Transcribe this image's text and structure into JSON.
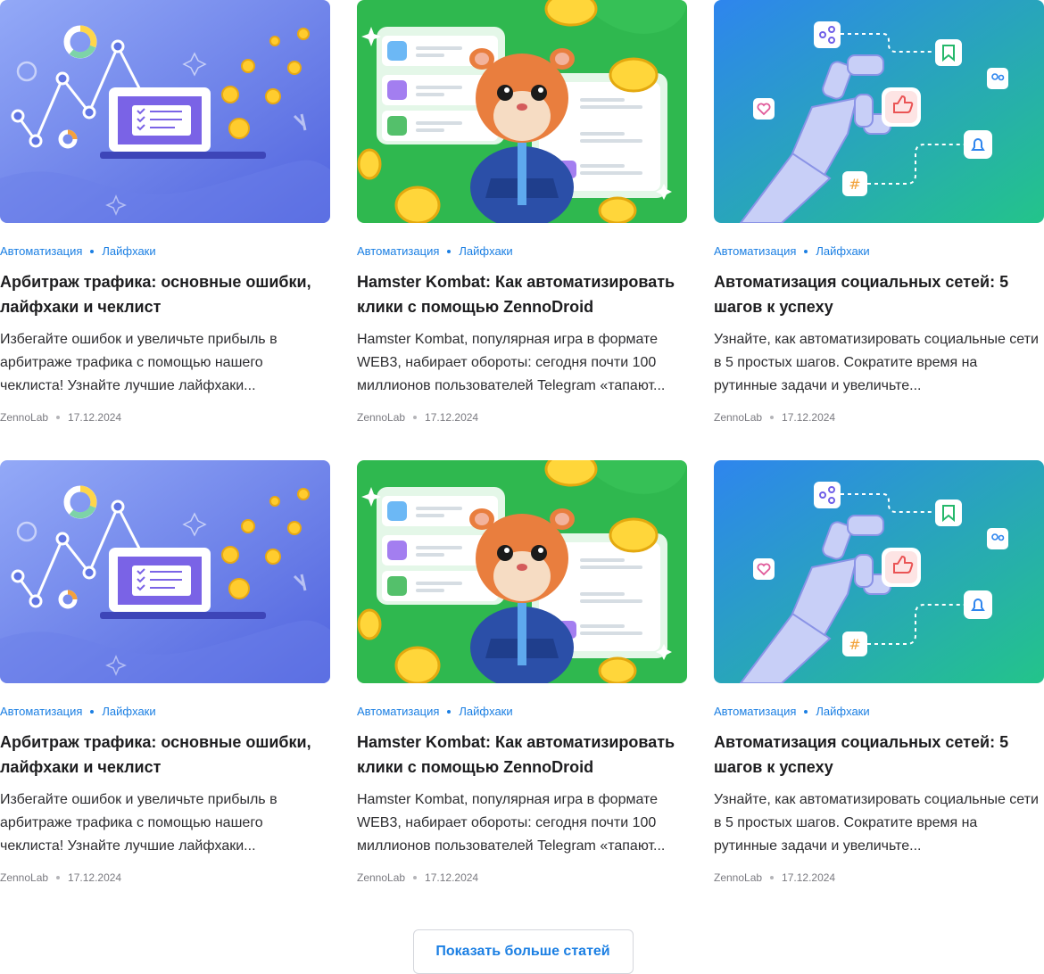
{
  "articles": [
    {
      "image": "arbitrage-illustration",
      "tags": [
        "Автоматизация",
        "Лайфхаки"
      ],
      "title": "Арбитраж трафика: основные ошибки, лайфхаки и чеклист",
      "excerpt": "Избегайте ошибок и увеличьте прибыль в арбитраже трафика с помощью нашего чеклиста! Узнайте лучшие лайфхаки...",
      "author": "ZennoLab",
      "date": "17.12.2024"
    },
    {
      "image": "hamster-kombat-illustration",
      "tags": [
        "Автоматизация",
        "Лайфхаки"
      ],
      "title": "Hamster Kombat: Как автоматизировать клики с помощью ZennoDroid",
      "excerpt": "Hamster Kombat, популярная игра в формате WEB3, набирает обороты: сегодня почти 100 миллионов пользователей Telegram «тапают...",
      "author": "ZennoLab",
      "date": "17.12.2024"
    },
    {
      "image": "social-automation-illustration",
      "tags": [
        "Автоматизация",
        "Лайфхаки"
      ],
      "title": "Автоматизация социальных сетей: 5 шагов к успеху",
      "excerpt": "Узнайте, как автоматизировать социальные сети в 5 простых шагов. Сократите время на рутинные задачи и увеличьте...",
      "author": "ZennoLab",
      "date": "17.12.2024"
    },
    {
      "image": "arbitrage-illustration",
      "tags": [
        "Автоматизация",
        "Лайфхаки"
      ],
      "title": "Арбитраж трафика: основные ошибки, лайфхаки и чеклист",
      "excerpt": "Избегайте ошибок и увеличьте прибыль в арбитраже трафика с помощью нашего чеклиста! Узнайте лучшие лайфхаки...",
      "author": "ZennoLab",
      "date": "17.12.2024"
    },
    {
      "image": "hamster-kombat-illustration",
      "tags": [
        "Автоматизация",
        "Лайфхаки"
      ],
      "title": "Hamster Kombat: Как автоматизировать клики с помощью ZennoDroid",
      "excerpt": "Hamster Kombat, популярная игра в формате WEB3, набирает обороты: сегодня почти 100 миллионов пользователей Telegram «тапают...",
      "author": "ZennoLab",
      "date": "17.12.2024"
    },
    {
      "image": "social-automation-illustration",
      "tags": [
        "Автоматизация",
        "Лайфхаки"
      ],
      "title": "Автоматизация социальных сетей: 5 шагов к успеху",
      "excerpt": "Узнайте, как автоматизировать социальные сети в 5 простых шагов. Сократите время на рутинные задачи и увеличьте...",
      "author": "ZennoLab",
      "date": "17.12.2024"
    }
  ],
  "show_more_label": "Показать больше статей",
  "colors": {
    "accent": "#1b7fe3",
    "arbitrage_bg_start": "#8aa3f5",
    "arbitrage_bg_end": "#5568df",
    "hamster_bg": "#2fb84f",
    "social_bg_start": "#2d86ec",
    "social_bg_end": "#25c08e"
  }
}
